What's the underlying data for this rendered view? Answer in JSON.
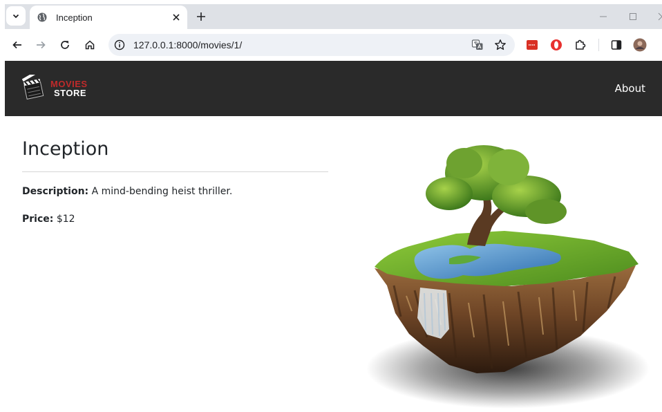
{
  "browser": {
    "tab_title": "Inception",
    "url": "127.0.0.1:8000/movies/1/"
  },
  "navbar": {
    "brand_line1": "MOVIES",
    "brand_line2": "STORE",
    "about_label": "About"
  },
  "movie": {
    "title": "Inception",
    "description_label": "Description:",
    "description": "A mind-bending heist thriller.",
    "price_label": "Price:",
    "price": "$12"
  },
  "colors": {
    "navbar_bg": "#2a2a2a",
    "brand_red": "#c02a2a",
    "tabstrip_bg": "#dee1e6"
  }
}
